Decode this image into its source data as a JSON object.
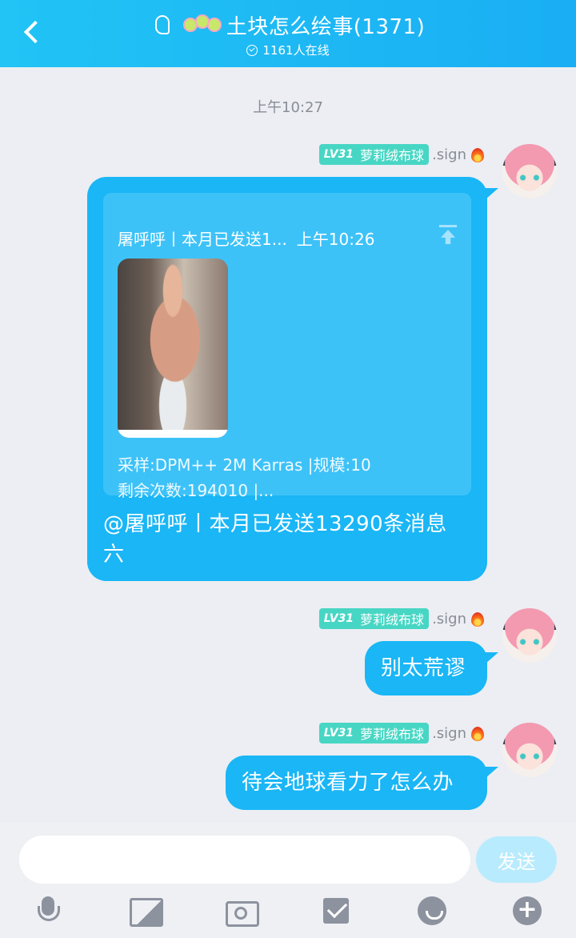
{
  "header": {
    "title": "土块怎么绘事(1371)",
    "online": "1161人在线"
  },
  "timestamp": "上午10:27",
  "sender": {
    "level": "LV31",
    "name": "萝莉绒布球",
    "sign": ".sign"
  },
  "messages": {
    "quote_head": "屠呼呼丨本月已发送1...",
    "quote_time": "上午10:26",
    "quote_line1": "采样:DPM++ 2M Karras |规模:10",
    "quote_line2": "剩余次数:194010  |...",
    "reply_line1": "@屠呼呼丨本月已发送13290条消息",
    "reply_line2": "六",
    "msg2": "别太荒谬",
    "msg3": "待会地球看力了怎么办"
  },
  "input": {
    "placeholder": "",
    "send_label": "发送"
  },
  "icons": {
    "toolbar": [
      "mic-icon",
      "image-icon",
      "camera-icon",
      "envelope-icon",
      "emoji-icon",
      "plus-icon"
    ],
    "accent": "#1ab6f6"
  }
}
